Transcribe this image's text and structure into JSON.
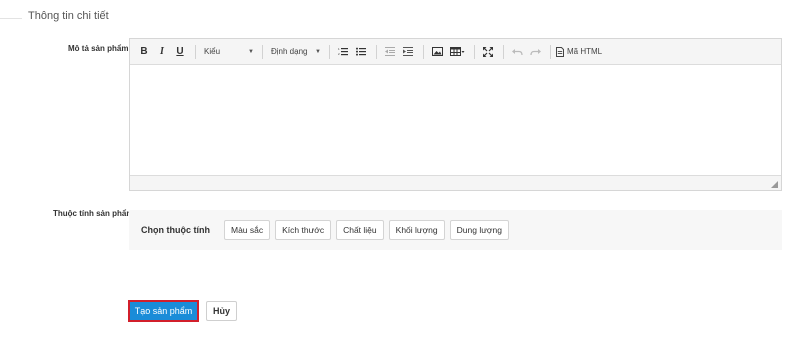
{
  "section": {
    "title": "Thông tin chi tiết"
  },
  "description_field": {
    "label": "Mô tả sản phẩm",
    "toolbar": {
      "bold": "B",
      "italic": "I",
      "underline": "U",
      "style_combo": "Kiểu",
      "format_combo": "Định dạng",
      "source_label": "Mã HTML"
    }
  },
  "attributes_field": {
    "label": "Thuộc tính sản phẩm",
    "choose_label": "Chọn thuộc tính",
    "chips": [
      "Màu sắc",
      "Kích thước",
      "Chất liệu",
      "Khối lượng",
      "Dung lượng"
    ]
  },
  "actions": {
    "create_label": "Tạo sản phẩm",
    "cancel_label": "Hủy"
  },
  "colors": {
    "primary": "#1a8cd8",
    "highlight_border": "#d21f2b"
  }
}
